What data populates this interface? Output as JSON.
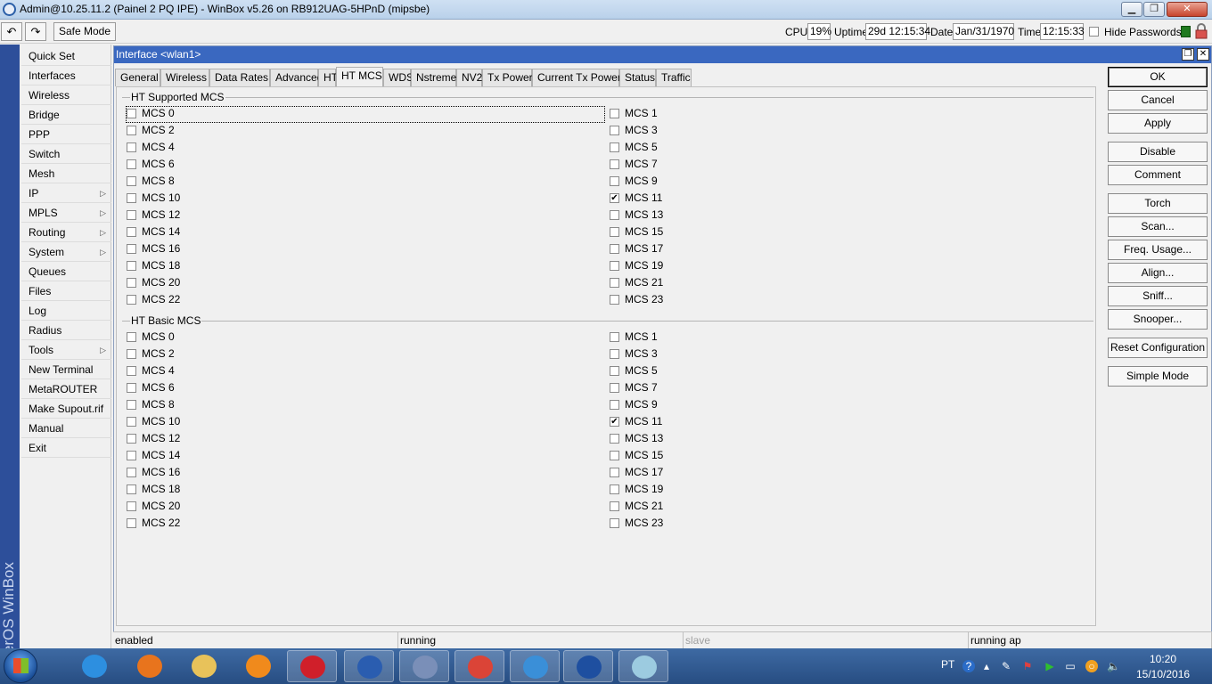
{
  "window": {
    "title": "Admin@10.25.11.2 (Painel 2 PQ IPE) - WinBox v5.26 on RB912UAG-5HPnD (mipsbe)",
    "min_label": "▁",
    "max_label": "❐",
    "close_label": "✕"
  },
  "toolbar": {
    "undo_label": "↶",
    "redo_label": "↷",
    "safe_mode_label": "Safe Mode",
    "cpu_label": "CPU:",
    "cpu_value": "19%",
    "uptime_label": "Uptime:",
    "uptime_value": "29d 12:15:34",
    "date_label": "Date:",
    "date_value": "Jan/31/1970",
    "time_label": "Time:",
    "time_value": "12:15:33",
    "hide_passwords_label": "Hide Passwords"
  },
  "brand": {
    "text": "RouterOS WinBox"
  },
  "menu": {
    "items": [
      {
        "label": "Quick Set"
      },
      {
        "label": "Interfaces"
      },
      {
        "label": "Wireless"
      },
      {
        "label": "Bridge"
      },
      {
        "label": "PPP"
      },
      {
        "label": "Switch"
      },
      {
        "label": "Mesh"
      },
      {
        "label": "IP",
        "submenu": "▷"
      },
      {
        "label": "MPLS",
        "submenu": "▷"
      },
      {
        "label": "Routing",
        "submenu": "▷"
      },
      {
        "label": "System",
        "submenu": "▷"
      },
      {
        "label": "Queues"
      },
      {
        "label": "Files"
      },
      {
        "label": "Log"
      },
      {
        "label": "Radius"
      },
      {
        "label": "Tools",
        "submenu": "▷"
      },
      {
        "label": "New Terminal"
      },
      {
        "label": "MetaROUTER"
      },
      {
        "label": "Make Supout.rif"
      },
      {
        "label": "Manual"
      },
      {
        "label": "Exit"
      }
    ]
  },
  "interface_window": {
    "title": "Interface <wlan1>",
    "tabs": [
      {
        "label": "General"
      },
      {
        "label": "Wireless"
      },
      {
        "label": "Data Rates"
      },
      {
        "label": "Advanced"
      },
      {
        "label": "HT"
      },
      {
        "label": "HT MCS",
        "active": true
      },
      {
        "label": "WDS"
      },
      {
        "label": "Nstreme"
      },
      {
        "label": "NV2"
      },
      {
        "label": "Tx Power"
      },
      {
        "label": "Current Tx Power"
      },
      {
        "label": "Status"
      },
      {
        "label": "Traffic"
      }
    ],
    "groups": [
      {
        "title": "HT Supported MCS",
        "options": [
          {
            "label": "MCS 0",
            "checked": false
          },
          {
            "label": "MCS 1",
            "checked": false
          },
          {
            "label": "MCS 2",
            "checked": false
          },
          {
            "label": "MCS 3",
            "checked": false
          },
          {
            "label": "MCS 4",
            "checked": false
          },
          {
            "label": "MCS 5",
            "checked": false
          },
          {
            "label": "MCS 6",
            "checked": false
          },
          {
            "label": "MCS 7",
            "checked": false
          },
          {
            "label": "MCS 8",
            "checked": false
          },
          {
            "label": "MCS 9",
            "checked": false
          },
          {
            "label": "MCS 10",
            "checked": false
          },
          {
            "label": "MCS 11",
            "checked": true
          },
          {
            "label": "MCS 12",
            "checked": false
          },
          {
            "label": "MCS 13",
            "checked": false
          },
          {
            "label": "MCS 14",
            "checked": false
          },
          {
            "label": "MCS 15",
            "checked": false
          },
          {
            "label": "MCS 16",
            "checked": false
          },
          {
            "label": "MCS 17",
            "checked": false
          },
          {
            "label": "MCS 18",
            "checked": false
          },
          {
            "label": "MCS 19",
            "checked": false
          },
          {
            "label": "MCS 20",
            "checked": false
          },
          {
            "label": "MCS 21",
            "checked": false
          },
          {
            "label": "MCS 22",
            "checked": false
          },
          {
            "label": "MCS 23",
            "checked": false
          }
        ]
      },
      {
        "title": "HT Basic MCS",
        "options": [
          {
            "label": "MCS 0",
            "checked": false
          },
          {
            "label": "MCS 1",
            "checked": false
          },
          {
            "label": "MCS 2",
            "checked": false
          },
          {
            "label": "MCS 3",
            "checked": false
          },
          {
            "label": "MCS 4",
            "checked": false
          },
          {
            "label": "MCS 5",
            "checked": false
          },
          {
            "label": "MCS 6",
            "checked": false
          },
          {
            "label": "MCS 7",
            "checked": false
          },
          {
            "label": "MCS 8",
            "checked": false
          },
          {
            "label": "MCS 9",
            "checked": false
          },
          {
            "label": "MCS 10",
            "checked": false
          },
          {
            "label": "MCS 11",
            "checked": true
          },
          {
            "label": "MCS 12",
            "checked": false
          },
          {
            "label": "MCS 13",
            "checked": false
          },
          {
            "label": "MCS 14",
            "checked": false
          },
          {
            "label": "MCS 15",
            "checked": false
          },
          {
            "label": "MCS 16",
            "checked": false
          },
          {
            "label": "MCS 17",
            "checked": false
          },
          {
            "label": "MCS 18",
            "checked": false
          },
          {
            "label": "MCS 19",
            "checked": false
          },
          {
            "label": "MCS 20",
            "checked": false
          },
          {
            "label": "MCS 21",
            "checked": false
          },
          {
            "label": "MCS 22",
            "checked": false
          },
          {
            "label": "MCS 23",
            "checked": false
          }
        ]
      }
    ],
    "buttons": [
      {
        "label": "OK",
        "name": "ok-button"
      },
      {
        "label": "Cancel",
        "name": "cancel-button"
      },
      {
        "label": "Apply",
        "name": "apply-button"
      },
      {
        "label": "Disable",
        "name": "disable-button"
      },
      {
        "label": "Comment",
        "name": "comment-button"
      },
      {
        "label": "Torch",
        "name": "torch-button"
      },
      {
        "label": "Scan...",
        "name": "scan-button"
      },
      {
        "label": "Freq. Usage...",
        "name": "freq-usage-button"
      },
      {
        "label": "Align...",
        "name": "align-button"
      },
      {
        "label": "Sniff...",
        "name": "sniff-button"
      },
      {
        "label": "Snooper...",
        "name": "snooper-button"
      },
      {
        "label": "Reset Configuration",
        "name": "reset-configuration-button"
      },
      {
        "label": "Simple Mode",
        "name": "simple-mode-button"
      }
    ],
    "status": [
      "enabled",
      "running",
      "slave",
      "running ap"
    ]
  },
  "taskbar": {
    "apps": [
      {
        "name": "internet-explorer-icon",
        "color": "#2d8fe0"
      },
      {
        "name": "firefox-icon",
        "color": "#e8741d"
      },
      {
        "name": "file-explorer-icon",
        "color": "#e8c25a"
      },
      {
        "name": "media-player-icon",
        "color": "#f08a1c"
      },
      {
        "name": "red-app-icon",
        "color": "#d01f2a"
      },
      {
        "name": "network-app-icon",
        "color": "#2a5db0"
      },
      {
        "name": "keyboard-app-icon",
        "color": "#7a8fb8"
      },
      {
        "name": "chrome-icon",
        "color": "#db4437"
      },
      {
        "name": "remote-desktop-icon",
        "color": "#3a8fd8"
      },
      {
        "name": "winbox-icon",
        "color": "#1e4fa0"
      },
      {
        "name": "notepad-icon",
        "color": "#9ccbe0"
      }
    ],
    "language": "PT",
    "clock_time": "10:20",
    "clock_date": "15/10/2016"
  }
}
